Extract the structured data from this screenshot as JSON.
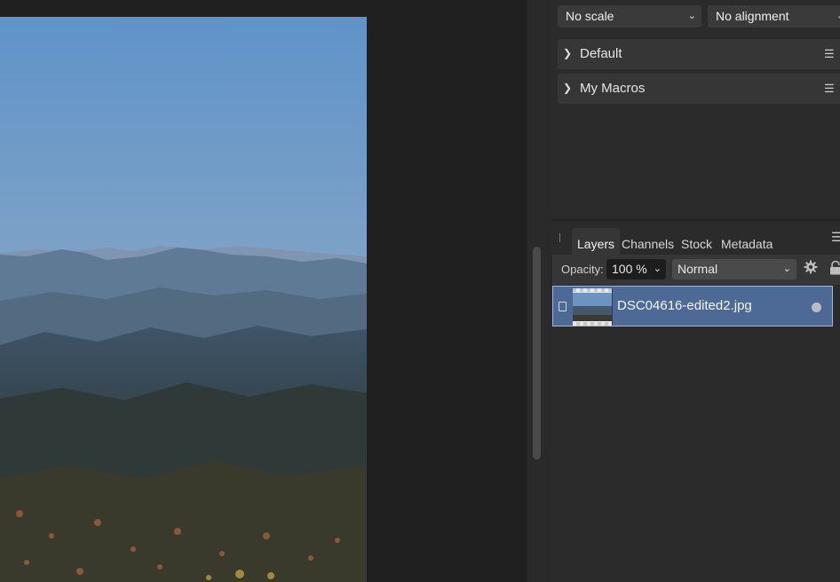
{
  "toolbar": {
    "scale": "No scale",
    "alignment": "No alignment"
  },
  "macros": {
    "items": [
      {
        "label": "Default"
      },
      {
        "label": "My Macros"
      }
    ]
  },
  "layers_panel": {
    "tabs": [
      "Layers",
      "Channels",
      "Stock",
      "Metadata"
    ],
    "active_tab": "Layers",
    "opacity_label": "Opacity:",
    "opacity_value": "100 %",
    "blend_mode": "Normal",
    "layers": [
      {
        "name": "DSC04616-edited2.jpg",
        "selected": true
      }
    ]
  },
  "icons": {
    "chevron": "chevron-down-icon",
    "expand": "chevron-right-icon",
    "menu": "hamburger-menu-icon",
    "gear": "gear-icon",
    "lock": "lock-icon"
  },
  "colors": {
    "selection": "#4d6a96",
    "panel": "#2b2b2b",
    "canvas_bg": "#202020"
  }
}
